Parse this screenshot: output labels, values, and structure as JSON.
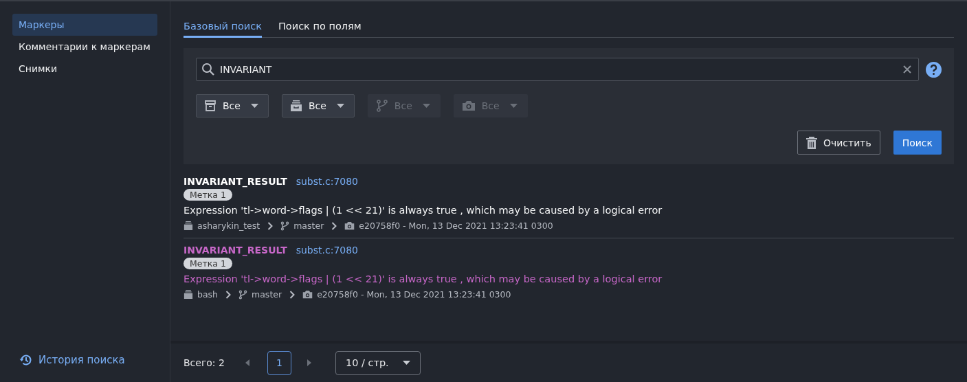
{
  "sidebar": {
    "items": [
      {
        "label": "Маркеры",
        "selected": true
      },
      {
        "label": "Комментарии к маркерам",
        "selected": false
      },
      {
        "label": "Снимки",
        "selected": false
      }
    ],
    "history_link": "История поиска"
  },
  "tabs": [
    {
      "label": "Базовый поиск",
      "selected": true
    },
    {
      "label": "Поиск по полям",
      "selected": false
    }
  ],
  "search": {
    "value": "INVARIANT"
  },
  "filters": [
    {
      "kind": "box",
      "label": "Все",
      "disabled": false
    },
    {
      "kind": "drawer",
      "label": "Все",
      "disabled": false
    },
    {
      "kind": "branch",
      "label": "Все",
      "disabled": true
    },
    {
      "kind": "camera",
      "label": "Все",
      "disabled": true
    }
  ],
  "buttons": {
    "clear": "Очистить",
    "search": "Поиск"
  },
  "results": [
    {
      "title": "INVARIANT_RESULT",
      "location": "subst.c:7080",
      "tag": "Метка 1",
      "message": "Expression 'tl->word->flags | (1 << 21)' is always true , which may be caused by a logical error",
      "project": "asharykin_test",
      "branch": "master",
      "snapshot": "e20758f0 - Mon, 13 Dec 2021 13:23:41 0300",
      "visited": false
    },
    {
      "title": "INVARIANT_RESULT",
      "location": "subst.c:7080",
      "tag": "Метка 1",
      "message": "Expression 'tl->word->flags | (1 << 21)' is always true , which may be caused by a logical error",
      "project": "bash",
      "branch": "master",
      "snapshot": "e20758f0 - Mon, 13 Dec 2021 13:23:41 0300",
      "visited": true
    }
  ],
  "pagination": {
    "total": "Всего: 2",
    "pages": [
      {
        "label": "1",
        "selected": true
      }
    ],
    "page_size": "10 / стр."
  }
}
